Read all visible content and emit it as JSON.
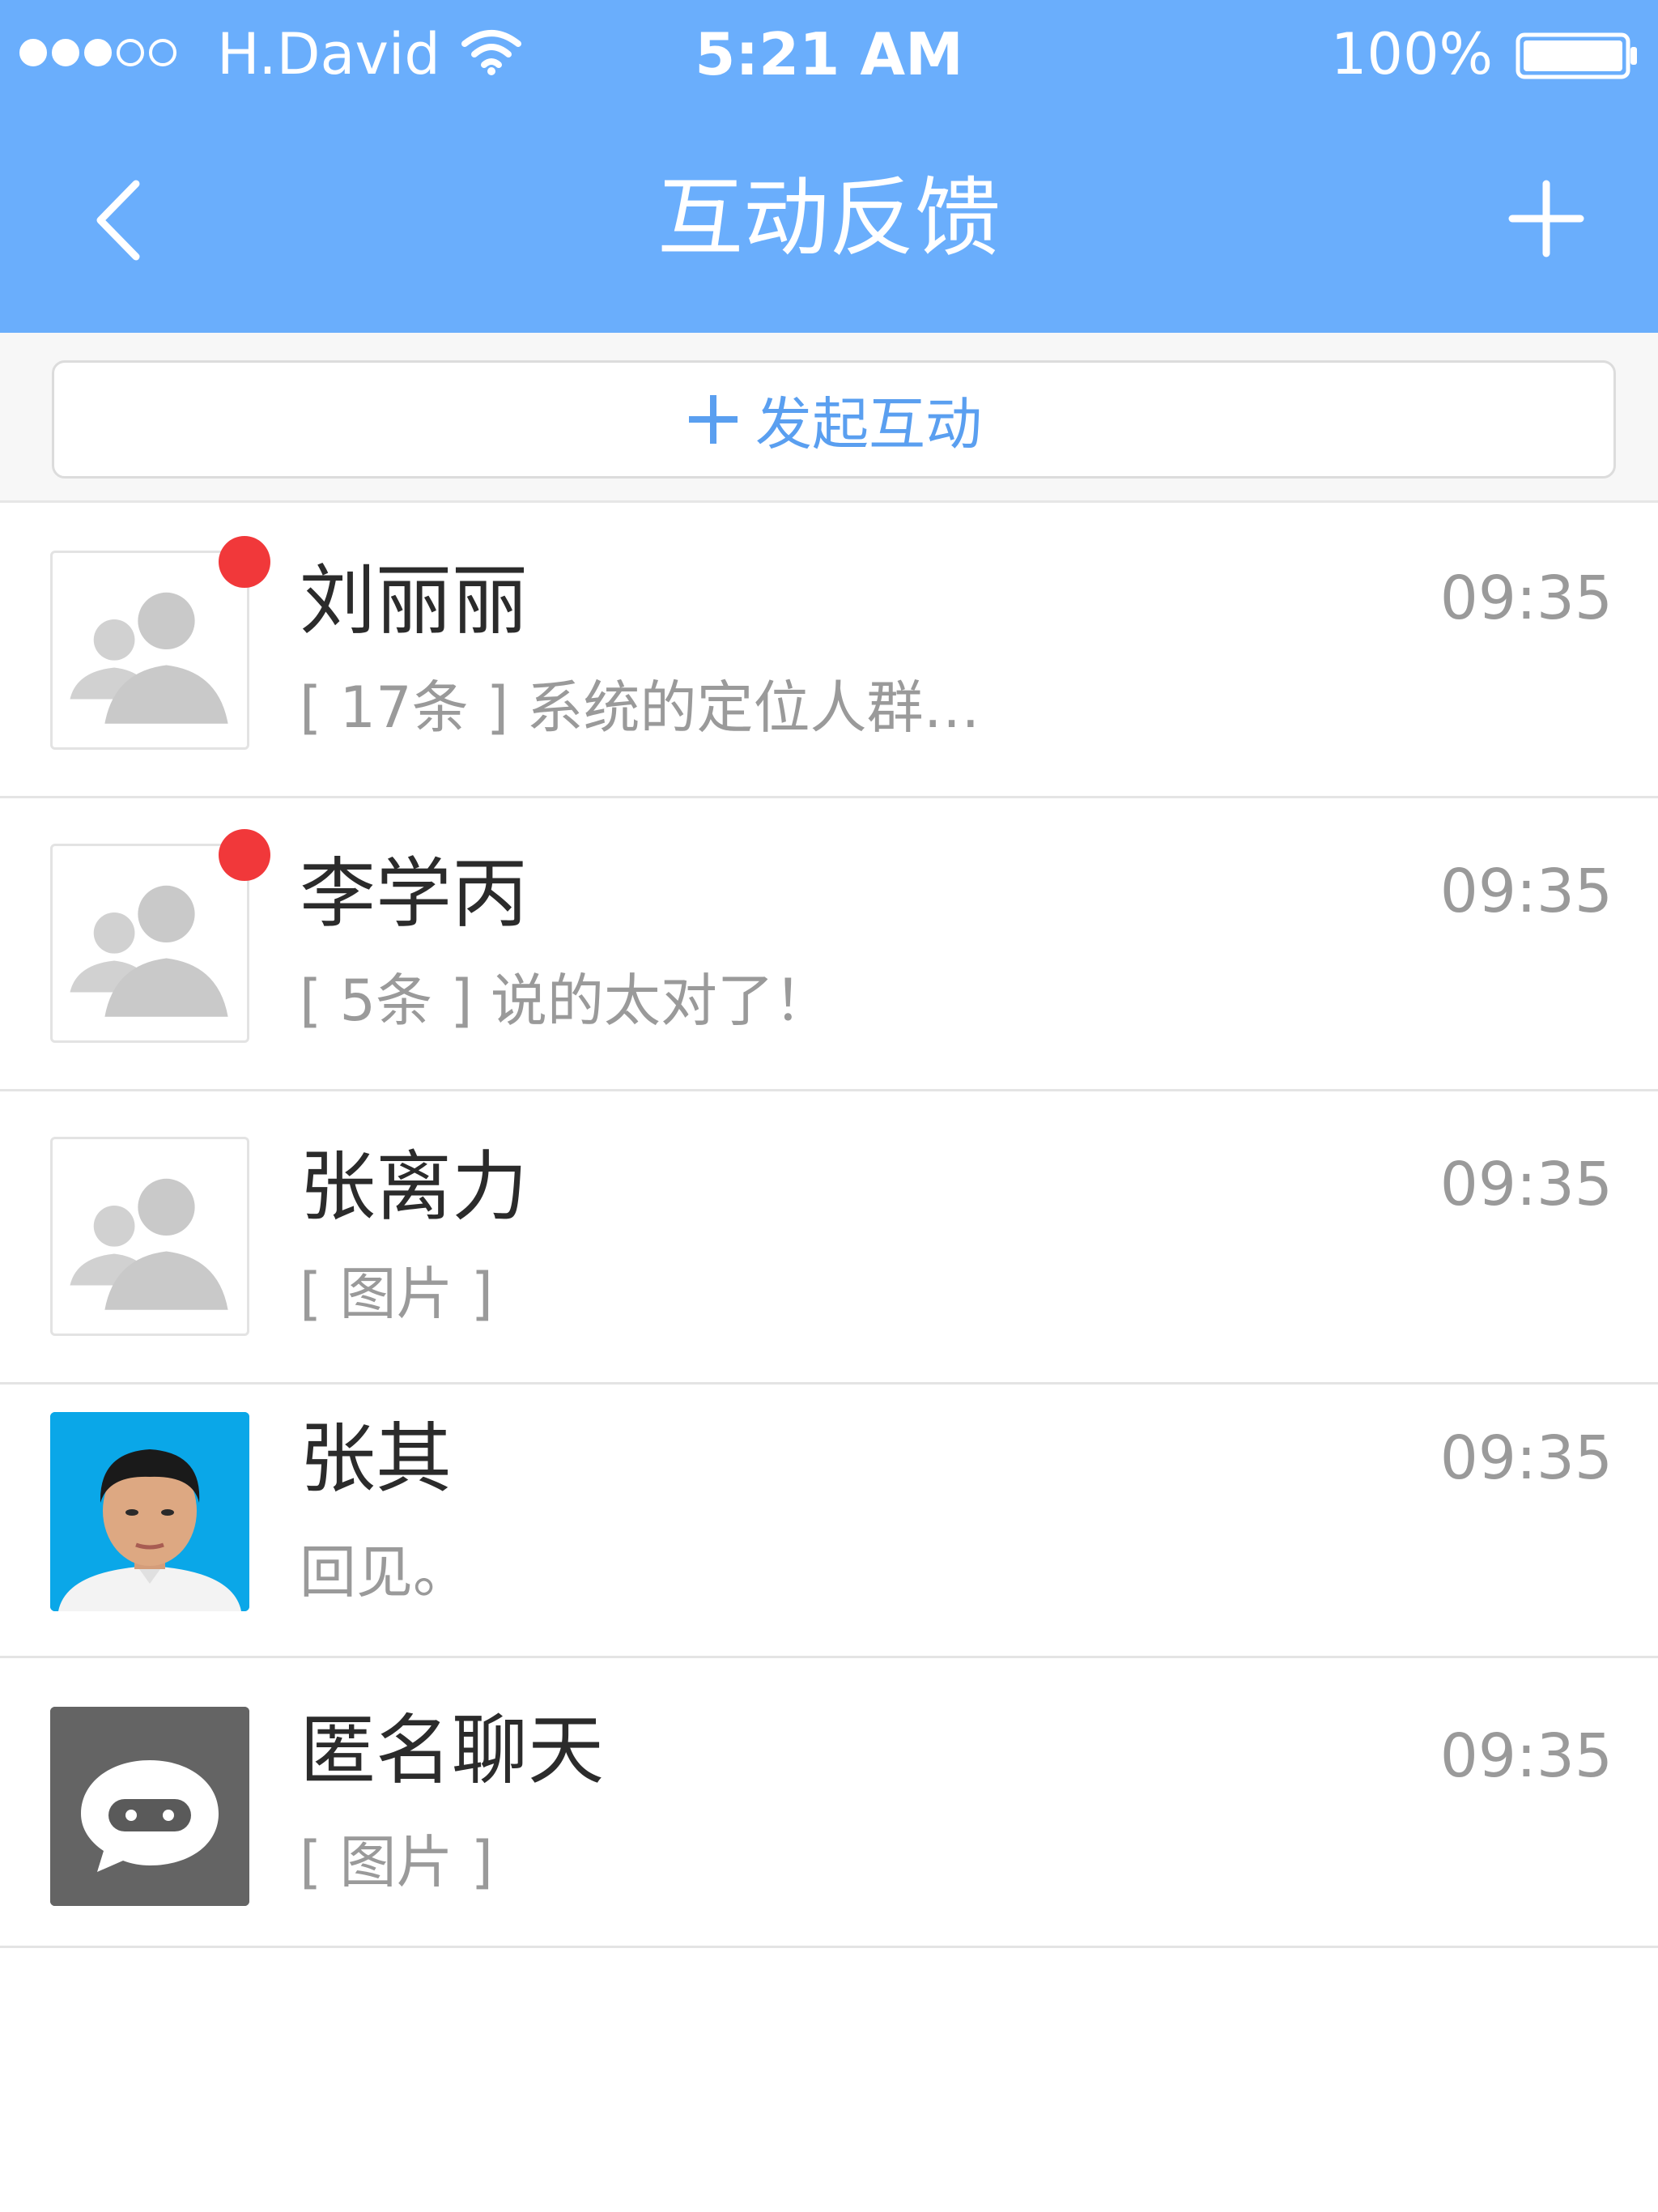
{
  "status_bar": {
    "signal_filled": 3,
    "signal_total": 5,
    "carrier": "H.David",
    "time": "5:21 AM",
    "battery_percent": "100%"
  },
  "nav": {
    "title": "互动反馈",
    "back_icon": "chevron-left-icon",
    "add_icon": "plus-icon"
  },
  "initiate": {
    "label": "发起互动",
    "icon": "plus-icon"
  },
  "conversations": [
    {
      "name": "刘丽丽",
      "preview": "[ 17条 ] 系统的定位人群…",
      "time": "09:35",
      "unread": true,
      "avatar": "default-group-avatar"
    },
    {
      "name": "李学丙",
      "preview": "[ 5条 ] 说的太对了！",
      "time": "09:35",
      "unread": true,
      "avatar": "default-group-avatar"
    },
    {
      "name": "张离力",
      "preview": "[ 图片 ]",
      "time": "09:35",
      "unread": false,
      "avatar": "default-group-avatar"
    },
    {
      "name": "张其",
      "preview": "回见。",
      "time": "09:35",
      "unread": false,
      "avatar": "photo-avatar"
    },
    {
      "name": "匿名聊天",
      "preview": "[ 图片 ]",
      "time": "09:35",
      "unread": false,
      "avatar": "anonymous-chat-avatar"
    }
  ],
  "colors": {
    "header_bg": "#6aaefc",
    "accent": "#5a9ff0",
    "unread_dot": "#f1383a",
    "name_text": "#2b2b2b",
    "secondary_text": "#9a9a9a"
  }
}
